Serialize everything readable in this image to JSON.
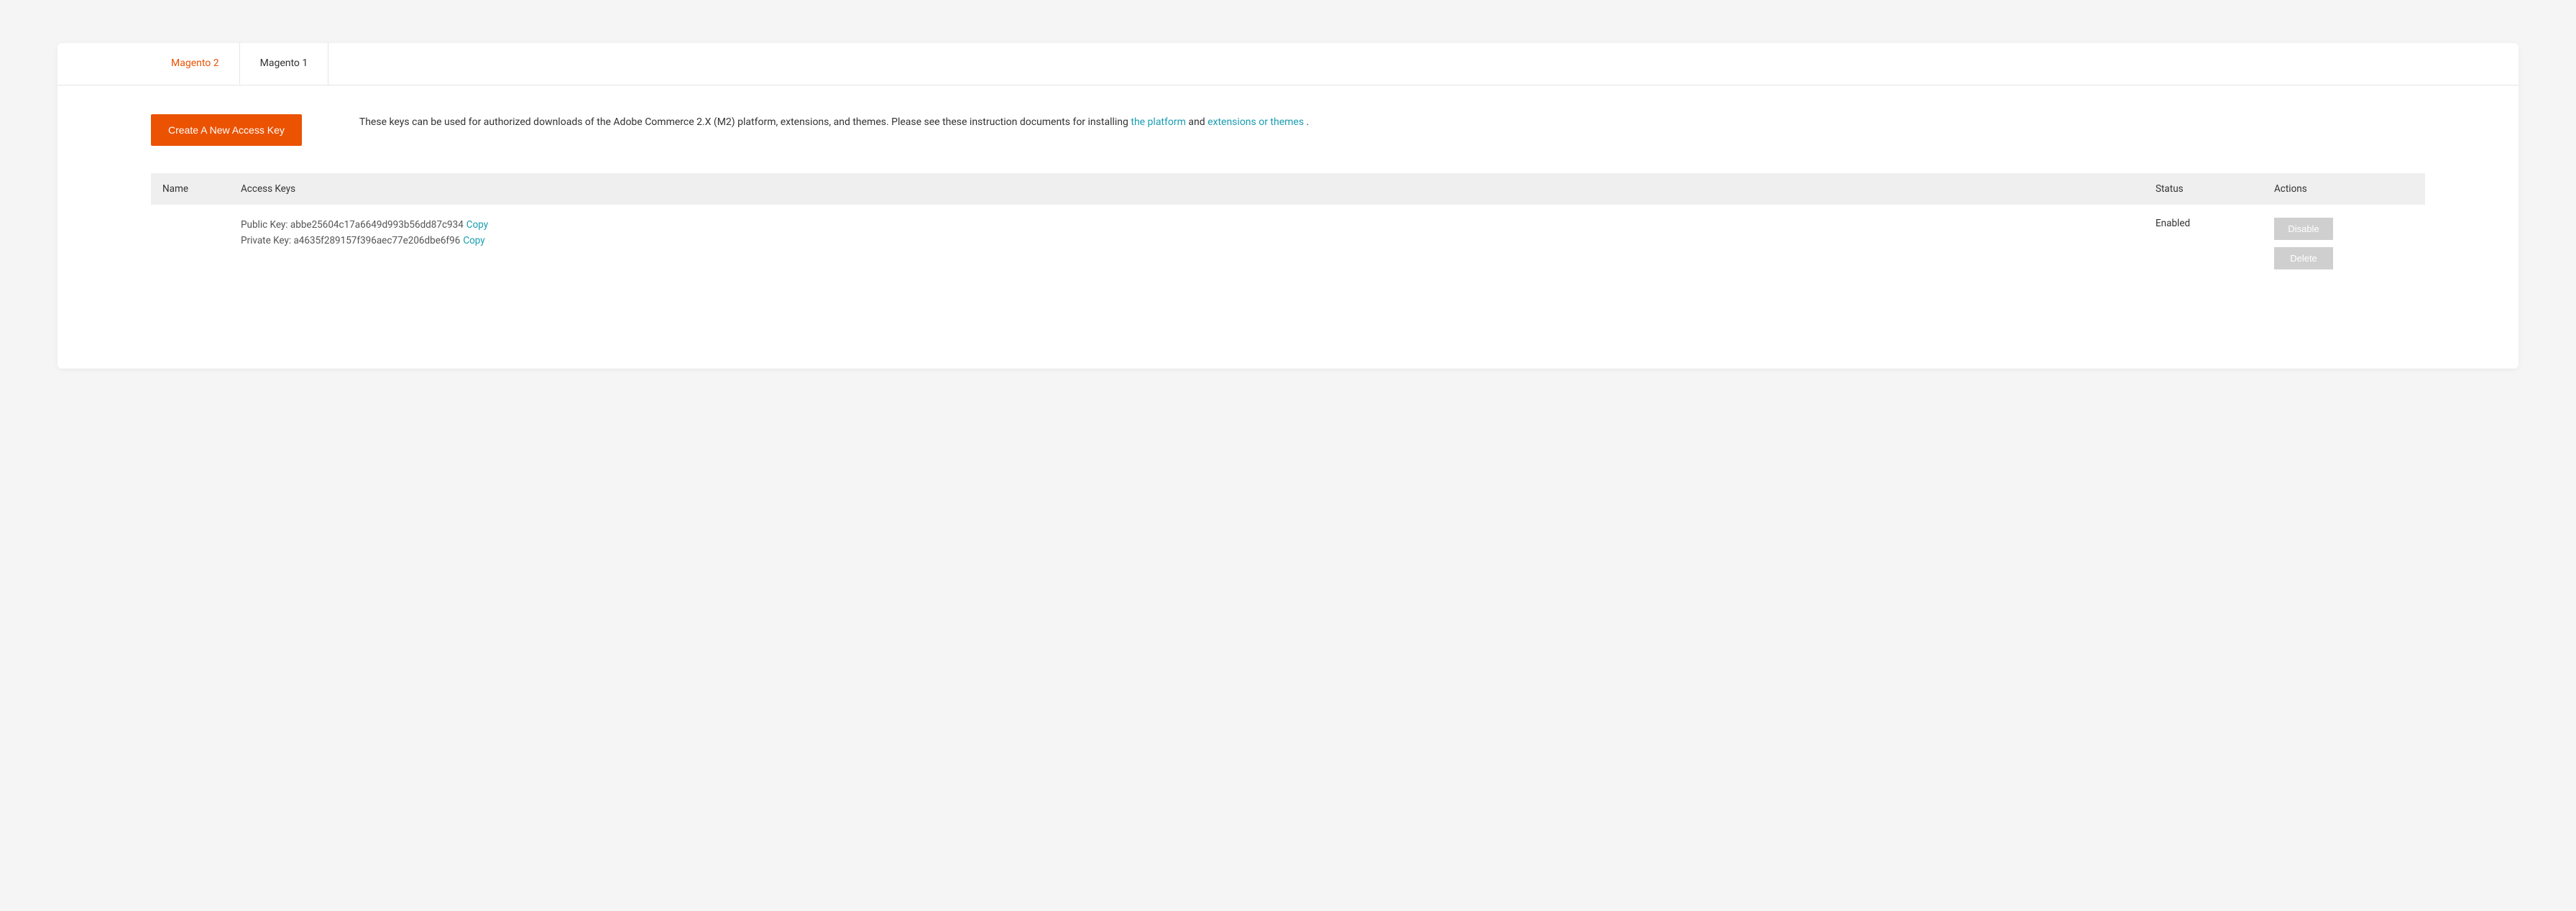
{
  "tabs": {
    "active": "Magento 2",
    "inactive": "Magento 1"
  },
  "create_button": "Create A New Access Key",
  "description": {
    "text_before": "These keys can be used for authorized downloads of the Adobe Commerce 2.X (M2) platform, extensions, and themes. Please see these instruction documents for installing ",
    "link1": "the platform",
    "text_mid": " and ",
    "link2": "extensions or themes",
    "text_after": " ."
  },
  "table": {
    "headers": {
      "name": "Name",
      "keys": "Access Keys",
      "status": "Status",
      "actions": "Actions"
    },
    "row": {
      "public_label": "Public Key: ",
      "public_value": "abbe25604c17a6649d993b56dd87c934",
      "public_copy": "Copy",
      "private_label": "Private Key: ",
      "private_value": "a4635f289157f396aec77e206dbe6f96",
      "private_copy": "Copy",
      "status": "Enabled",
      "disable": "Disable",
      "delete": "Delete"
    }
  }
}
